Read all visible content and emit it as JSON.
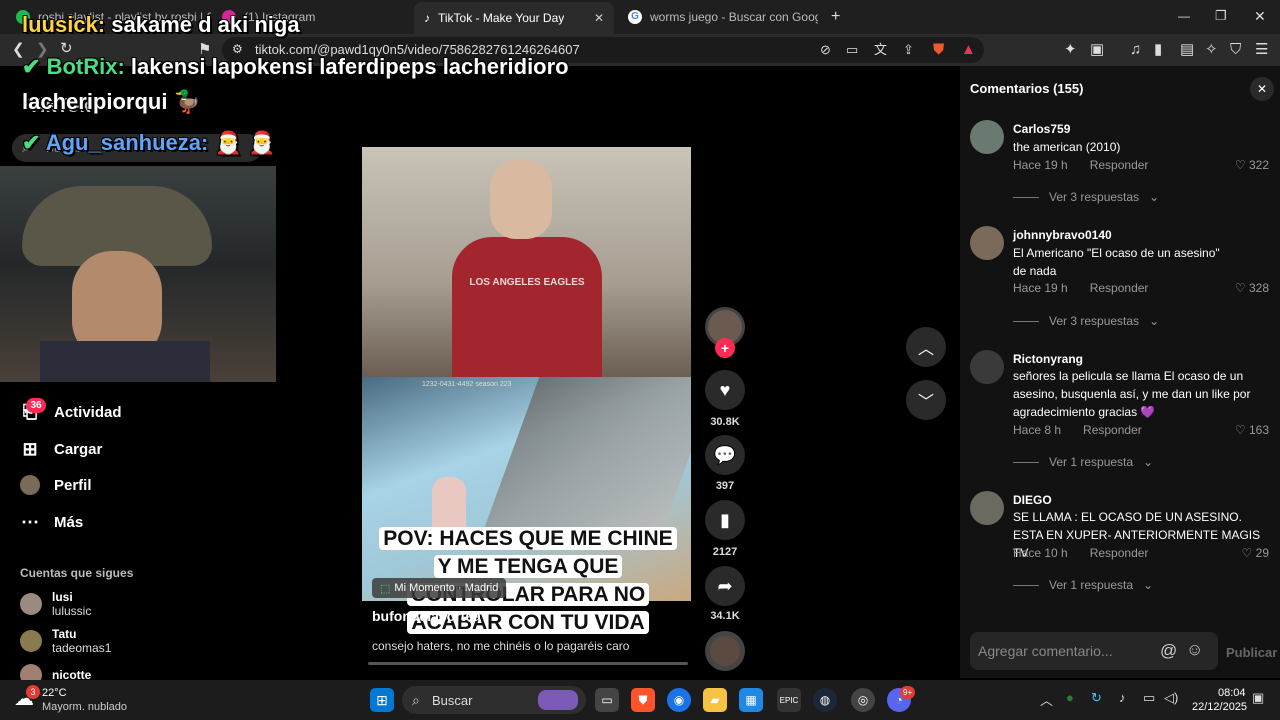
{
  "browser": {
    "tabs": [
      {
        "title": "rosbi playlist - playlist by rosbi | Spot",
        "active": false
      },
      {
        "title": "(1) Instagram",
        "active": false
      },
      {
        "title": "TikTok - Make Your Day",
        "active": true
      },
      {
        "title": "worms juego - Buscar con Google",
        "active": false
      }
    ],
    "new_tab": "+",
    "url": "tiktok.com/@pawd1qy0n5/video/7586282761246264607",
    "window_controls": {
      "minimize": "—",
      "maximize": "❐",
      "close": "✕"
    }
  },
  "stream_chat": [
    {
      "user": "luusick:",
      "message": "sakame d aki niga"
    },
    {
      "user": "BotRix:",
      "message": "lakensi lapokensi laferdipeps lacheridioro"
    },
    {
      "user": "",
      "message": "lacheripiorqui"
    },
    {
      "user": "Agu_sanhueza:",
      "message": "🎅 🎅"
    }
  ],
  "sidebar": {
    "brand": "TikTok",
    "search_placeholder": "Buscar",
    "nav": [
      {
        "label": "Actividad",
        "icon": "inbox-icon",
        "badge": "36"
      },
      {
        "label": "Cargar",
        "icon": "plus-square-icon"
      },
      {
        "label": "Perfil",
        "icon": "avatar"
      },
      {
        "label": "Más",
        "icon": "more-icon"
      }
    ],
    "following_title": "Cuentas que sigues",
    "following": [
      {
        "name": "lusi",
        "username": "lulussic"
      },
      {
        "name": "Tatu",
        "username": "tadeomas1"
      },
      {
        "name": "nicotte",
        "username": ""
      }
    ]
  },
  "video": {
    "caption": "POV: HACES QUE ME CHINE Y ME TENGA QUE CONTROLAR PARA NO ACABAR CON TU VIDA",
    "location": "Mi Momento · Madrid",
    "author": "bufondelacortea",
    "description": "consejo haters, no me chinéis o lo pagaréis caro",
    "game_hud": "1232-0431-4492 season 223",
    "shirt_text": "LOS ANGELES EAGLES"
  },
  "actions": {
    "likes": "30.8K",
    "comments": "397",
    "saves": "2127",
    "shares": "34.1K"
  },
  "comments_panel": {
    "title": "Comentarios (155)",
    "input_placeholder": "Agregar comentario...",
    "post_label": "Publicar",
    "reply_label": "Responder",
    "items": [
      {
        "user": "Carlos759",
        "text": "the american (2010)",
        "time": "Hace 19 h",
        "likes": "322",
        "more": "Ver 3 respuestas"
      },
      {
        "user": "johnnybravo0140",
        "text": "El Americano \"El ocaso de un asesino\" de nada",
        "time": "Hace 19 h",
        "likes": "328",
        "more": "Ver 3 respuestas"
      },
      {
        "user": "Rictonyrang",
        "text": "señores la pelicula se llama El ocaso de un asesino, busquenla así, y me dan un like por agradecimiento gracias 💜",
        "time": "Hace 8 h",
        "likes": "163",
        "more": "Ver 1 respuesta"
      },
      {
        "user": "DIEGO",
        "text": "SE LLAMA : EL OCASO DE UN ASESINO. ESTA EN XUPER- ANTERIORMENTE MAGIS TV",
        "time": "Hace 10 h",
        "likes": "29",
        "more": "Ver 1 respuesta"
      }
    ]
  },
  "taskbar": {
    "weather_temp": "22°C",
    "weather_desc": "Mayorm. nublado",
    "weather_badge": "3",
    "search_label": "Buscar",
    "time": "08:04",
    "date": "22/12/2025",
    "discord_badge": "9+"
  }
}
